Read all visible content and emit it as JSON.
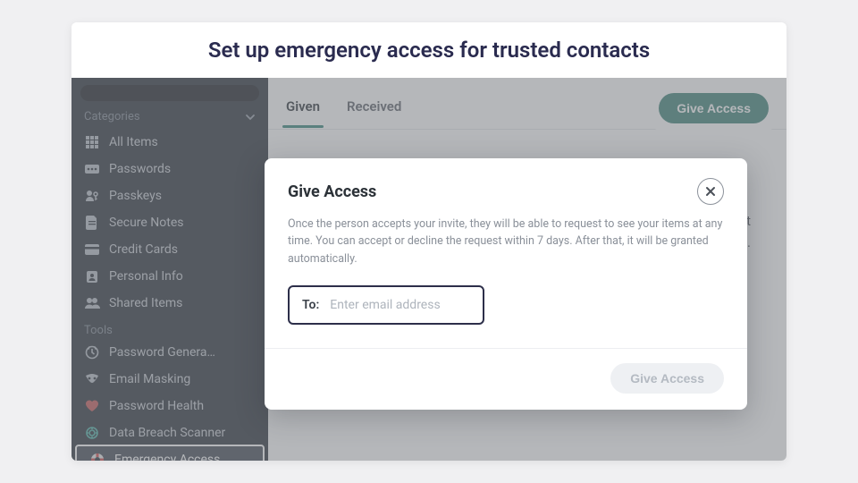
{
  "caption": "Set up emergency access for trusted contacts",
  "sidebar": {
    "categories_label": "Categories",
    "tools_label": "Tools",
    "items": [
      {
        "label": "All Items",
        "icon": "grid-icon"
      },
      {
        "label": "Passwords",
        "icon": "password-icon"
      },
      {
        "label": "Passkeys",
        "icon": "passkey-icon"
      },
      {
        "label": "Secure Notes",
        "icon": "note-icon"
      },
      {
        "label": "Credit Cards",
        "icon": "card-icon"
      },
      {
        "label": "Personal Info",
        "icon": "person-icon"
      },
      {
        "label": "Shared Items",
        "icon": "people-icon"
      }
    ],
    "tools": [
      {
        "label": "Password Genera…",
        "icon": "generator-icon"
      },
      {
        "label": "Email Masking",
        "icon": "mask-icon"
      },
      {
        "label": "Password Health",
        "icon": "heart-icon"
      },
      {
        "label": "Data Breach Scanner",
        "icon": "scanner-icon"
      },
      {
        "label": "Emergency Access",
        "icon": "lifering-icon"
      }
    ]
  },
  "tabs": {
    "given": "Given",
    "received": "Received"
  },
  "header_button": "Give Access",
  "main_fragment_1": "annot",
  "main_fragment_2": "e.",
  "modal": {
    "title": "Give Access",
    "description": "Once the person accepts your invite, they will be able to request to see your items at any time. You can accept or decline the request within 7 days. After that, it will be granted automatically.",
    "to_label": "To:",
    "placeholder": "Enter email address",
    "submit": "Give Access"
  }
}
